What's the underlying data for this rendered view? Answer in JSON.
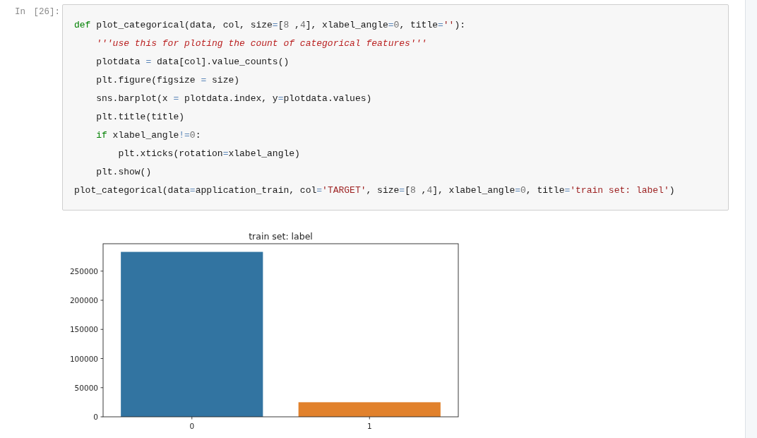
{
  "cell": {
    "prompt": "In [26]:",
    "code_lines": [
      [
        {
          "kind": "keyword",
          "text": "def"
        },
        {
          "kind": "text",
          "text": " plot_categorical(data, col, size"
        },
        {
          "kind": "operator",
          "text": "="
        },
        {
          "kind": "text",
          "text": "["
        },
        {
          "kind": "number",
          "text": "8"
        },
        {
          "kind": "text",
          "text": " ,"
        },
        {
          "kind": "number",
          "text": "4"
        },
        {
          "kind": "text",
          "text": "], xlabel_angle"
        },
        {
          "kind": "operator",
          "text": "="
        },
        {
          "kind": "number",
          "text": "0"
        },
        {
          "kind": "text",
          "text": ", title"
        },
        {
          "kind": "operator",
          "text": "="
        },
        {
          "kind": "string",
          "text": "''"
        },
        {
          "kind": "text",
          "text": "):"
        }
      ],
      [
        {
          "kind": "docstring",
          "text": "    '''use this for ploting the count of categorical features'''"
        }
      ],
      [
        {
          "kind": "text",
          "text": "    plotdata "
        },
        {
          "kind": "operator",
          "text": "="
        },
        {
          "kind": "text",
          "text": " data[col].value_counts()"
        }
      ],
      [
        {
          "kind": "text",
          "text": "    plt.figure(figsize "
        },
        {
          "kind": "operator",
          "text": "="
        },
        {
          "kind": "text",
          "text": " size)"
        }
      ],
      [
        {
          "kind": "text",
          "text": "    sns.barplot(x "
        },
        {
          "kind": "operator",
          "text": "="
        },
        {
          "kind": "text",
          "text": " plotdata.index, y"
        },
        {
          "kind": "operator",
          "text": "="
        },
        {
          "kind": "text",
          "text": "plotdata.values)"
        }
      ],
      [
        {
          "kind": "text",
          "text": "    plt.title(title)"
        }
      ],
      [
        {
          "kind": "keyword",
          "text": "    if"
        },
        {
          "kind": "text",
          "text": " xlabel_angle"
        },
        {
          "kind": "operator",
          "text": "!="
        },
        {
          "kind": "number",
          "text": "0"
        },
        {
          "kind": "text",
          "text": ":"
        }
      ],
      [
        {
          "kind": "text",
          "text": "        plt.xticks(rotation"
        },
        {
          "kind": "operator",
          "text": "="
        },
        {
          "kind": "text",
          "text": "xlabel_angle)"
        }
      ],
      [
        {
          "kind": "text",
          "text": "    plt.show()"
        }
      ],
      [
        {
          "kind": "text",
          "text": "plot_categorical(data"
        },
        {
          "kind": "operator",
          "text": "="
        },
        {
          "kind": "text",
          "text": "application_train, col"
        },
        {
          "kind": "operator",
          "text": "="
        },
        {
          "kind": "string",
          "text": "'TARGET'"
        },
        {
          "kind": "text",
          "text": ", size"
        },
        {
          "kind": "operator",
          "text": "="
        },
        {
          "kind": "text",
          "text": "["
        },
        {
          "kind": "number",
          "text": "8"
        },
        {
          "kind": "text",
          "text": " ,"
        },
        {
          "kind": "number",
          "text": "4"
        },
        {
          "kind": "text",
          "text": "], xlabel_angle"
        },
        {
          "kind": "operator",
          "text": "="
        },
        {
          "kind": "number",
          "text": "0"
        },
        {
          "kind": "text",
          "text": ", title"
        },
        {
          "kind": "operator",
          "text": "="
        },
        {
          "kind": "string",
          "text": "'train set: label'"
        },
        {
          "kind": "text",
          "text": ")"
        }
      ]
    ],
    "output": {
      "chart_data": {
        "type": "bar",
        "title": "train set: label",
        "categories": [
          "0",
          "1"
        ],
        "values": [
          283000,
          25000
        ],
        "colors": [
          "#3274a1",
          "#e1812c"
        ],
        "ylim": [
          0,
          297000
        ],
        "yticks": [
          0,
          50000,
          100000,
          150000,
          200000,
          250000
        ]
      }
    }
  }
}
